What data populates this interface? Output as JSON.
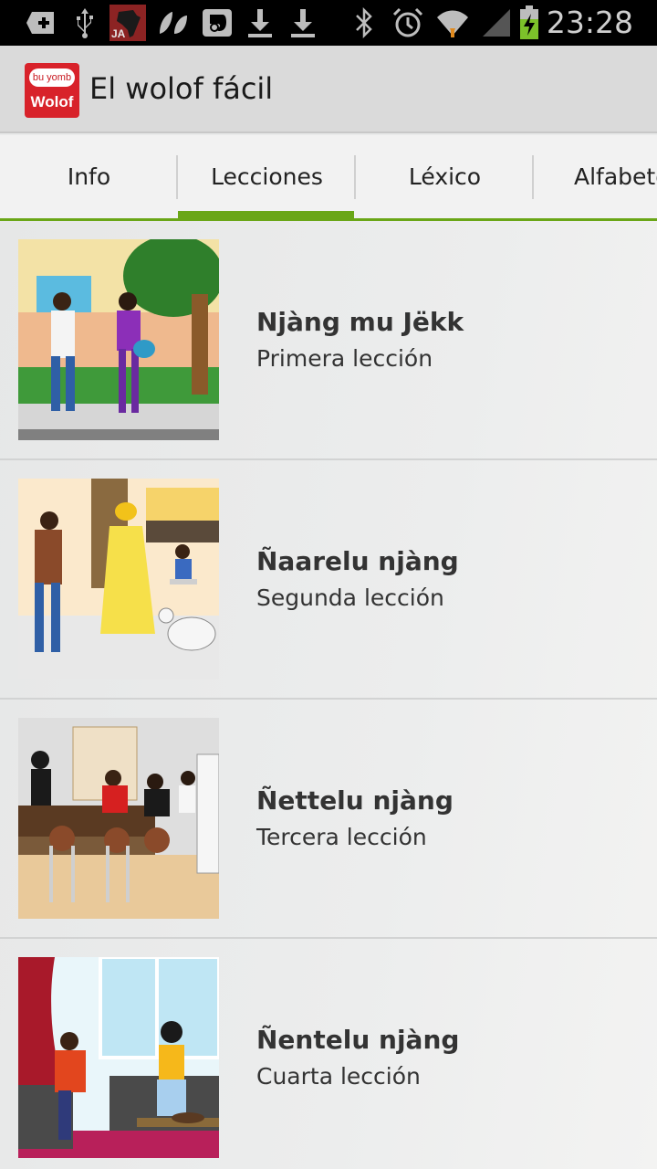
{
  "status_bar": {
    "time": "23:28",
    "icons": [
      "add-box-icon",
      "usb-icon",
      "africa-map-ja-icon",
      "leaf-icon",
      "evernote-icon",
      "download-icon",
      "download-icon",
      "bluetooth-icon",
      "alarm-icon",
      "wifi-icon",
      "signal-icon",
      "battery-charging-icon"
    ],
    "notif_label": "JA"
  },
  "app_bar": {
    "title": "El wolof fácil",
    "logo_top": "bu yomb",
    "logo_bottom": "Wolof"
  },
  "tabs": [
    {
      "label": "Info",
      "selected": false
    },
    {
      "label": "Lecciones",
      "selected": true
    },
    {
      "label": "Léxico",
      "selected": false
    },
    {
      "label": "Alfabeto",
      "selected": false
    }
  ],
  "lessons": [
    {
      "title": "Njàng mu Jëkk",
      "subtitle": "Primera lección",
      "image": "two-people-greeting-illustration"
    },
    {
      "title": "Ñaarelu njàng",
      "subtitle": "Segunda lección",
      "image": "family-with-goats-illustration"
    },
    {
      "title": "Ñettelu njàng",
      "subtitle": "Tercera lección",
      "image": "bar-scene-illustration"
    },
    {
      "title": "Ñentelu njàng",
      "subtitle": "Cuarta lección",
      "image": "living-room-illustration"
    }
  ],
  "colors": {
    "accent": "#6aa617",
    "logo_red": "#d8222a",
    "status_bar": "#000000"
  }
}
